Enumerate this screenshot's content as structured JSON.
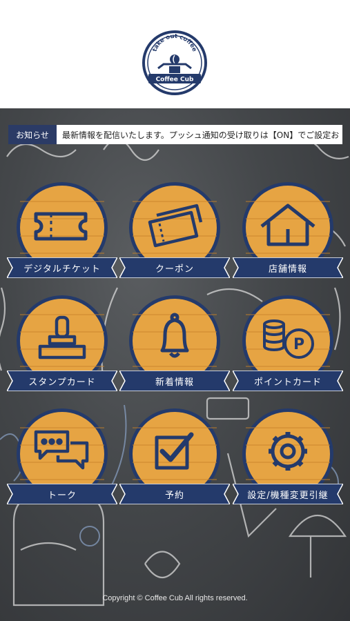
{
  "logo": {
    "arc_text": "take out coffee",
    "brand": "Coffee Cub",
    "icon": "scooter-coffee-logo"
  },
  "notice": {
    "label": "お知らせ",
    "text": "最新情報を配信いたします。プッシュ通知の受け取りは【ON】でご設定お"
  },
  "menu": [
    {
      "label": "デジタルチケット",
      "icon": "ticket-icon"
    },
    {
      "label": "クーポン",
      "icon": "coupon-icon"
    },
    {
      "label": "店舗情報",
      "icon": "house-icon"
    },
    {
      "label": "スタンプカード",
      "icon": "stamp-icon"
    },
    {
      "label": "新着情報",
      "icon": "bell-icon"
    },
    {
      "label": "ポイントカード",
      "icon": "coins-points-icon"
    },
    {
      "label": "トーク",
      "icon": "chat-bubbles-icon"
    },
    {
      "label": "予約",
      "icon": "checkbox-icon"
    },
    {
      "label": "設定/機種変更引継",
      "icon": "gear-icon"
    }
  ],
  "footer": {
    "copyright": "Copyright © Coffee Cub All rights reserved."
  },
  "colors": {
    "navy": "#243a6b",
    "wood": "#e6a443",
    "board": "#46494c"
  }
}
